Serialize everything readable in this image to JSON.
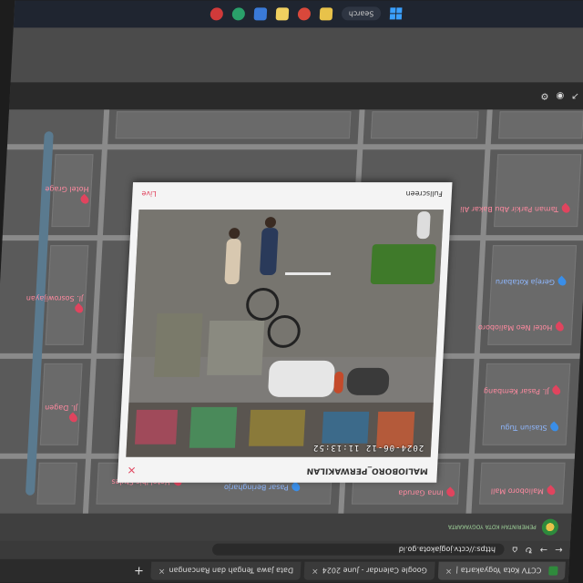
{
  "browser": {
    "tabs": [
      {
        "label": "CCTV Kota Yogyakarta |",
        "active": true
      },
      {
        "label": "Google Calendar - June 2024",
        "active": false
      },
      {
        "label": "Data Jawa Tengah dan Rancangan",
        "active": false
      }
    ],
    "url": "https://cctv.jogjakota.go.id",
    "nav_icons": [
      "back-icon",
      "forward-icon",
      "refresh-icon",
      "home-icon"
    ]
  },
  "site": {
    "logo_text": "PEMERINTAH KOTA YOGYAKARTA"
  },
  "map": {
    "pois": [
      {
        "text": "Malioboro Mall",
        "color": "red"
      },
      {
        "text": "Inna Garuda",
        "color": "red"
      },
      {
        "text": "Pasar Beringharjo",
        "color": "blue"
      },
      {
        "text": "Hotel Ibis Styles",
        "color": "red"
      },
      {
        "text": "Stasiun Tugu",
        "color": "blue"
      },
      {
        "text": "Jl. Pasar Kembang",
        "color": "red"
      },
      {
        "text": "Hotel Neo Malioboro",
        "color": "red"
      },
      {
        "text": "Gereja Kotabaru",
        "color": "blue"
      },
      {
        "text": "Taman Parkir Abu Bakar Ali",
        "color": "red"
      },
      {
        "text": "Jl. Dagen",
        "color": "red"
      },
      {
        "text": "Jl. Sosrowijayan",
        "color": "red"
      },
      {
        "text": "Hotel Grage",
        "color": "red"
      }
    ]
  },
  "modal": {
    "title": "MALIOBORO_PERWAKILAN",
    "timestamp": "2024-06-12 11:13:52",
    "live_label": "Live",
    "fullscreen_label": "Fullscreen",
    "close_symbol": "×"
  },
  "taskbar": {
    "search_label": "Search"
  },
  "colors": {
    "accent": "#e0445e",
    "map_bg": "#5a5a5a",
    "modal_bg": "#f4f4f4"
  }
}
